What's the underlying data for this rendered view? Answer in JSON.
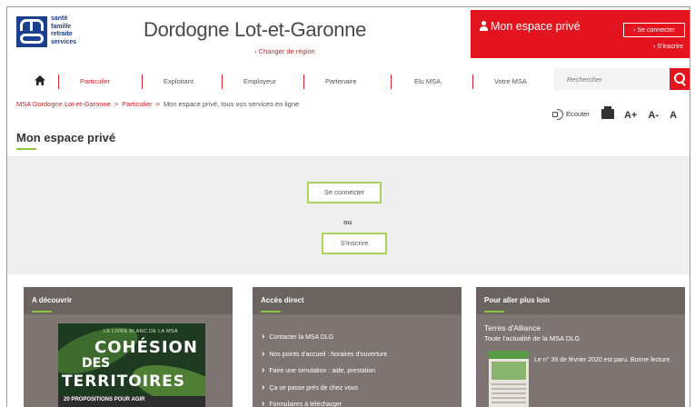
{
  "header": {
    "logo_lines": [
      "santé",
      "famille",
      "retraite",
      "services"
    ],
    "region_title": "Dordogne Lot-et-Garonne",
    "change_region": "› Changer de région",
    "espace_prive": {
      "title": "Mon espace privé",
      "connect_button": "› Se connecter",
      "register_link": "› S'inscrire"
    }
  },
  "nav": {
    "items": [
      "Particulier",
      "Exploitant",
      "Employeur",
      "Partenaire",
      "Elu MSA",
      "Votre MSA"
    ],
    "active": "Particulier",
    "search_placeholder": "Rechercher"
  },
  "breadcrumb": {
    "items": [
      "MSA Dordogne Lot-et-Garonne",
      "Particulier",
      "Mon espace privé, tous vos services en ligne"
    ],
    "separator": ">"
  },
  "tools": {
    "listen": "Ecouter",
    "font_increase": "A+",
    "font_decrease": "A-",
    "font_reset": "A"
  },
  "page": {
    "title": "Mon espace privé",
    "connect_button": "Se connecter",
    "or_text": "ou",
    "register_button": "S'inscrire"
  },
  "cards": {
    "discover": {
      "title": "A découvrir",
      "cover_small": "LE LIVRE BLANC DE LA MSA",
      "cover_line1": "COHÉSION",
      "cover_line2": "DES",
      "cover_line3": "TERRITOIRES",
      "cover_footer": "20 PROPOSITIONS POUR AGIR"
    },
    "direct_access": {
      "title": "Accès direct",
      "links": [
        "Contacter la MSA DLG",
        "Nos points d'accueil : horaires d'ouverture",
        "Faire une simulation : aide, prestation",
        "Ça se passe près de chez vous",
        "Formulaires à télécharger"
      ]
    },
    "further": {
      "title": "Pour aller plus loin",
      "magazine_title": "Terres d'Alliance",
      "magazine_subtitle": "Toute l'actualité de la MSA DLG",
      "magazine_desc": "Le n° 39 de février 2020 est paru. Bonne lecture."
    }
  },
  "colors": {
    "brand_red": "#e3141e",
    "accent_green": "#8cc63f",
    "card_bg": "#7e7572",
    "logo_blue": "#1a3f8f"
  }
}
